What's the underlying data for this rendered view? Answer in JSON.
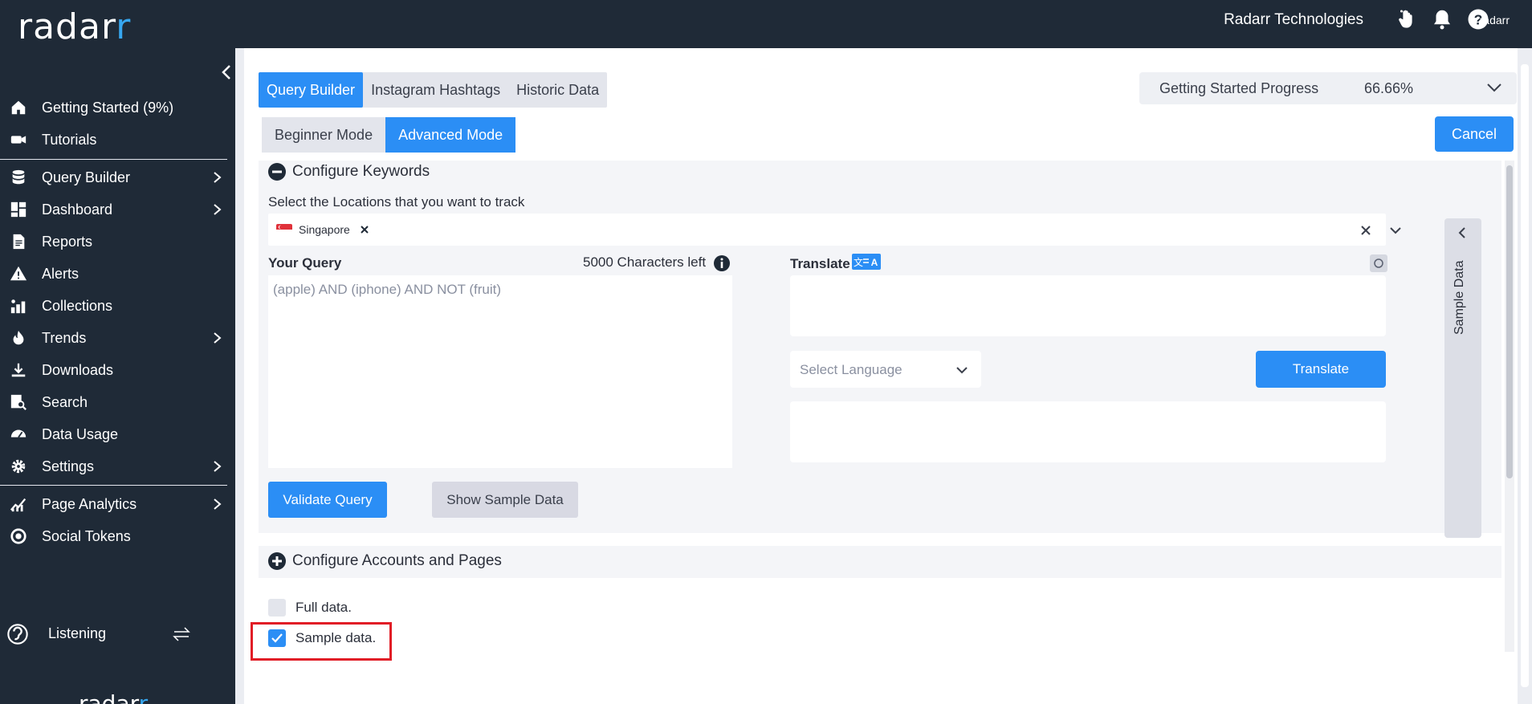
{
  "brand": {
    "logo_text": "radar",
    "logo_accent": "r",
    "mini_logo": "radarr"
  },
  "topbar": {
    "user": "Radarr Technologies"
  },
  "sidebar": {
    "items": [
      {
        "label": "Getting Started (9%)",
        "icon": "home-icon"
      },
      {
        "label": "Tutorials",
        "icon": "video-icon"
      },
      {
        "label": "Query Builder",
        "icon": "database-icon"
      },
      {
        "label": "Dashboard",
        "icon": "dashboard-icon"
      },
      {
        "label": "Reports",
        "icon": "report-icon"
      },
      {
        "label": "Alerts",
        "icon": "alert-icon"
      },
      {
        "label": "Collections",
        "icon": "collections-icon"
      },
      {
        "label": "Trends",
        "icon": "trends-icon"
      },
      {
        "label": "Downloads",
        "icon": "download-icon"
      },
      {
        "label": "Search",
        "icon": "search-icon"
      },
      {
        "label": "Data Usage",
        "icon": "gauge-icon"
      },
      {
        "label": "Settings",
        "icon": "gear-icon"
      },
      {
        "label": "Page Analytics",
        "icon": "analytics-icon"
      },
      {
        "label": "Social Tokens",
        "icon": "token-icon"
      }
    ],
    "listening": "Listening"
  },
  "tabs": [
    "Query Builder",
    "Instagram Hashtags",
    "Historic Data"
  ],
  "modes": [
    "Beginner Mode",
    "Advanced Mode"
  ],
  "progress": {
    "label": "Getting Started Progress",
    "value": "66.66%"
  },
  "cancel_label": "Cancel",
  "keywords": {
    "title": "Configure Keywords",
    "locations_label": "Select the Locations that you want to track",
    "location_chip": "Singapore",
    "query_label": "Your Query",
    "chars_left": "5000 Characters left",
    "query_placeholder": "(apple) AND (iphone) AND NOT (fruit)",
    "translate_label": "Translate",
    "language_placeholder": "Select Language",
    "translate_button": "Translate",
    "validate_button": "Validate Query",
    "sample_button": "Show Sample Data"
  },
  "sample_panel_label": "Sample Data",
  "accounts": {
    "title": "Configure Accounts and Pages",
    "full_data": "Full data.",
    "sample_data": "Sample data."
  },
  "colors": {
    "accent": "#2b8ef5",
    "sidebar": "#1f2a37",
    "highlight": "#e11d26"
  }
}
